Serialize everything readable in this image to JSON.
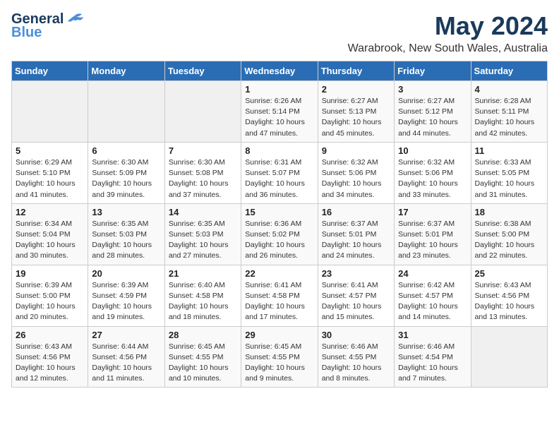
{
  "logo": {
    "general": "General",
    "blue": "Blue"
  },
  "title": "May 2024",
  "subtitle": "Warabrook, New South Wales, Australia",
  "columns": [
    "Sunday",
    "Monday",
    "Tuesday",
    "Wednesday",
    "Thursday",
    "Friday",
    "Saturday"
  ],
  "weeks": [
    [
      {
        "day": "",
        "info": ""
      },
      {
        "day": "",
        "info": ""
      },
      {
        "day": "",
        "info": ""
      },
      {
        "day": "1",
        "info": "Sunrise: 6:26 AM\nSunset: 5:14 PM\nDaylight: 10 hours\nand 47 minutes."
      },
      {
        "day": "2",
        "info": "Sunrise: 6:27 AM\nSunset: 5:13 PM\nDaylight: 10 hours\nand 45 minutes."
      },
      {
        "day": "3",
        "info": "Sunrise: 6:27 AM\nSunset: 5:12 PM\nDaylight: 10 hours\nand 44 minutes."
      },
      {
        "day": "4",
        "info": "Sunrise: 6:28 AM\nSunset: 5:11 PM\nDaylight: 10 hours\nand 42 minutes."
      }
    ],
    [
      {
        "day": "5",
        "info": "Sunrise: 6:29 AM\nSunset: 5:10 PM\nDaylight: 10 hours\nand 41 minutes."
      },
      {
        "day": "6",
        "info": "Sunrise: 6:30 AM\nSunset: 5:09 PM\nDaylight: 10 hours\nand 39 minutes."
      },
      {
        "day": "7",
        "info": "Sunrise: 6:30 AM\nSunset: 5:08 PM\nDaylight: 10 hours\nand 37 minutes."
      },
      {
        "day": "8",
        "info": "Sunrise: 6:31 AM\nSunset: 5:07 PM\nDaylight: 10 hours\nand 36 minutes."
      },
      {
        "day": "9",
        "info": "Sunrise: 6:32 AM\nSunset: 5:06 PM\nDaylight: 10 hours\nand 34 minutes."
      },
      {
        "day": "10",
        "info": "Sunrise: 6:32 AM\nSunset: 5:06 PM\nDaylight: 10 hours\nand 33 minutes."
      },
      {
        "day": "11",
        "info": "Sunrise: 6:33 AM\nSunset: 5:05 PM\nDaylight: 10 hours\nand 31 minutes."
      }
    ],
    [
      {
        "day": "12",
        "info": "Sunrise: 6:34 AM\nSunset: 5:04 PM\nDaylight: 10 hours\nand 30 minutes."
      },
      {
        "day": "13",
        "info": "Sunrise: 6:35 AM\nSunset: 5:03 PM\nDaylight: 10 hours\nand 28 minutes."
      },
      {
        "day": "14",
        "info": "Sunrise: 6:35 AM\nSunset: 5:03 PM\nDaylight: 10 hours\nand 27 minutes."
      },
      {
        "day": "15",
        "info": "Sunrise: 6:36 AM\nSunset: 5:02 PM\nDaylight: 10 hours\nand 26 minutes."
      },
      {
        "day": "16",
        "info": "Sunrise: 6:37 AM\nSunset: 5:01 PM\nDaylight: 10 hours\nand 24 minutes."
      },
      {
        "day": "17",
        "info": "Sunrise: 6:37 AM\nSunset: 5:01 PM\nDaylight: 10 hours\nand 23 minutes."
      },
      {
        "day": "18",
        "info": "Sunrise: 6:38 AM\nSunset: 5:00 PM\nDaylight: 10 hours\nand 22 minutes."
      }
    ],
    [
      {
        "day": "19",
        "info": "Sunrise: 6:39 AM\nSunset: 5:00 PM\nDaylight: 10 hours\nand 20 minutes."
      },
      {
        "day": "20",
        "info": "Sunrise: 6:39 AM\nSunset: 4:59 PM\nDaylight: 10 hours\nand 19 minutes."
      },
      {
        "day": "21",
        "info": "Sunrise: 6:40 AM\nSunset: 4:58 PM\nDaylight: 10 hours\nand 18 minutes."
      },
      {
        "day": "22",
        "info": "Sunrise: 6:41 AM\nSunset: 4:58 PM\nDaylight: 10 hours\nand 17 minutes."
      },
      {
        "day": "23",
        "info": "Sunrise: 6:41 AM\nSunset: 4:57 PM\nDaylight: 10 hours\nand 15 minutes."
      },
      {
        "day": "24",
        "info": "Sunrise: 6:42 AM\nSunset: 4:57 PM\nDaylight: 10 hours\nand 14 minutes."
      },
      {
        "day": "25",
        "info": "Sunrise: 6:43 AM\nSunset: 4:56 PM\nDaylight: 10 hours\nand 13 minutes."
      }
    ],
    [
      {
        "day": "26",
        "info": "Sunrise: 6:43 AM\nSunset: 4:56 PM\nDaylight: 10 hours\nand 12 minutes."
      },
      {
        "day": "27",
        "info": "Sunrise: 6:44 AM\nSunset: 4:56 PM\nDaylight: 10 hours\nand 11 minutes."
      },
      {
        "day": "28",
        "info": "Sunrise: 6:45 AM\nSunset: 4:55 PM\nDaylight: 10 hours\nand 10 minutes."
      },
      {
        "day": "29",
        "info": "Sunrise: 6:45 AM\nSunset: 4:55 PM\nDaylight: 10 hours\nand 9 minutes."
      },
      {
        "day": "30",
        "info": "Sunrise: 6:46 AM\nSunset: 4:55 PM\nDaylight: 10 hours\nand 8 minutes."
      },
      {
        "day": "31",
        "info": "Sunrise: 6:46 AM\nSunset: 4:54 PM\nDaylight: 10 hours\nand 7 minutes."
      },
      {
        "day": "",
        "info": ""
      }
    ]
  ]
}
